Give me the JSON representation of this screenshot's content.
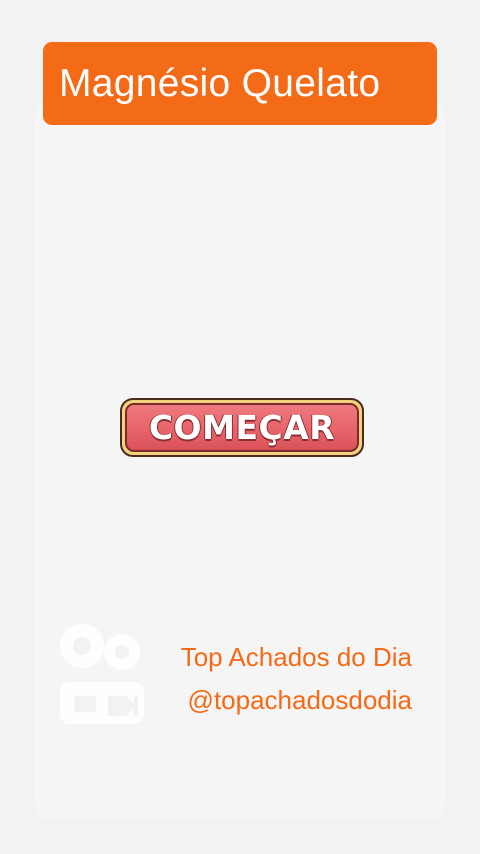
{
  "header": {
    "title": "Magnésio Quelato"
  },
  "main": {
    "start_button_label": "COMEÇAR"
  },
  "footer": {
    "brand_name": "Top Achados do Dia",
    "handle": "@topachadosdodia",
    "watermark_icon": "kwai-logo-icon"
  },
  "colors": {
    "accent": "#f36a17",
    "button_fill": "#e8636a",
    "button_border": "#f2d27a",
    "background": "#f2f2f2"
  }
}
